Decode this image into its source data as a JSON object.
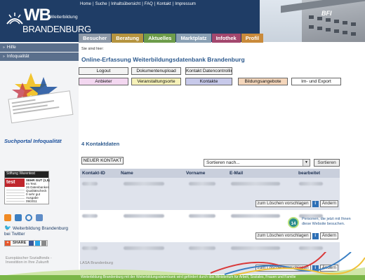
{
  "header": {
    "logo_wb": "WB",
    "logo_sub": "Weiterbildung",
    "logo_brand": "BRANDENBURG",
    "top_links": [
      "Home",
      "Suche",
      "Inhaltsübersicht",
      "FAQ",
      "Kontakt",
      "Impressum"
    ],
    "building_sign": "BFI"
  },
  "mainnav": [
    {
      "label": "Besucher",
      "color": "#8d99a8"
    },
    {
      "label": "Beratung",
      "color": "#b5943f"
    },
    {
      "label": "Aktuelles",
      "color": "#6d9c4a"
    },
    {
      "label": "Marktplatz",
      "color": "#8aa0b4"
    },
    {
      "label": "Infothek",
      "color": "#a3476e"
    },
    {
      "label": "Profil",
      "color": "#c98a3a"
    }
  ],
  "sidebar": {
    "items": [
      {
        "label": "Hilfe"
      },
      {
        "label": "Infoqualität"
      }
    ],
    "infoquality_label": "Suchportal Infoqualität",
    "stiftung": {
      "header": "Stiftung Warentest",
      "rating": "SEHR GUT (1,5)",
      "test_label": "test",
      "lines": [
        "Im Test:",
        "26 Datenbanken",
        "Qualitätscheck",
        "0 sehr gut",
        "Ausgabe",
        "09/2011"
      ]
    },
    "twitter_text": "Weiterbildung Brandenburg bei Twitter",
    "share_label": "SHARE"
  },
  "content": {
    "breadcrumb": "Sie sind hier:",
    "title": "Online-Erfassung Weiterbildungsdatenbank Brandenburg",
    "buttons_row1": [
      "Logout",
      "Dokumentenupload",
      "Kontakt Datencontrolling"
    ],
    "buttons_row2": [
      {
        "label": "Anbieter",
        "color": "#f3d7f0"
      },
      {
        "label": "Veranstaltungsorte",
        "color": "#f6f1b8"
      },
      {
        "label": "Kontakte",
        "color": "#c7c9ea"
      },
      {
        "label": "Bildungsangebote",
        "color": "#f4d6bb"
      },
      {
        "label": "Im- und Export",
        "color": "#ffffff"
      }
    ],
    "count_label": "4 Kontaktdaten",
    "new_contact": "NEUER KONTAKT",
    "sort_placeholder": "Sortieren nach...",
    "sort_button": "Sortieren",
    "table_headers": [
      "Kontakt-ID",
      "Name",
      "Vorname",
      "E-Mail",
      "bearbeitet"
    ],
    "row_actions": {
      "suggest_delete": "zum Löschen vorschlagen",
      "info": "i",
      "edit": "Ändern"
    },
    "row_count": 3
  },
  "visitors": {
    "count": "14",
    "text": "Personen, die jetzt mit Ihnen diese Website besuchen."
  },
  "footer": {
    "esf": "Europäischer Sozialfonds - Investition in Ihre Zukunft",
    "lasa": "LASA Brandenburg",
    "strip": "Weiterbildung Brandenburg mit der Weiterbildungsdatenbank wird gefördert durch das Ministerium für Arbeit, Soziales, Frauen und Familie"
  }
}
